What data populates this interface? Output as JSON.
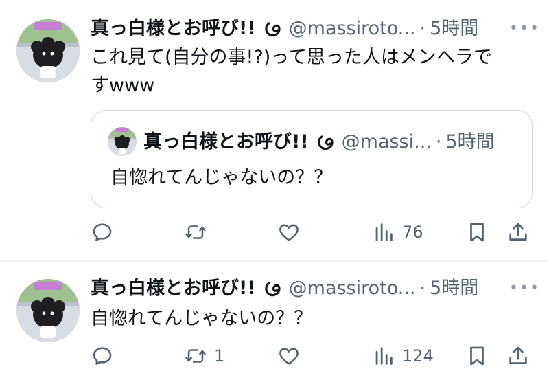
{
  "posts": [
    {
      "display_name": "真っ白様とお呼び!!",
      "handle": "@massiroto...",
      "separator": "·",
      "time": "5時間",
      "more": "•••",
      "text_line1": "これ見て(自分の事!?)って思った人はメンヘラで",
      "text_line2": "すwww",
      "quote": {
        "display_name": "真っ白様とお呼び!!",
        "handle": "@massi...",
        "separator": "·",
        "time": "5時間",
        "text": "自惚れてんじゃないの？？"
      },
      "actions": {
        "reply_count": "",
        "repost_count": "",
        "like_count": "",
        "views_count": "76"
      }
    },
    {
      "display_name": "真っ白様とお呼び!!",
      "handle": "@massiroto...",
      "separator": "·",
      "time": "5時間",
      "more": "•••",
      "text_line1": "自惚れてんじゃないの？？",
      "actions": {
        "reply_count": "",
        "repost_count": "1",
        "like_count": "",
        "views_count": "124"
      }
    }
  ],
  "colors": {
    "text": "#0f1419",
    "secondary": "#536471",
    "border": "#cfd9de",
    "divider": "#eff3f4"
  },
  "icons": [
    "reply-icon",
    "repost-icon",
    "like-icon",
    "views-icon",
    "bookmark-icon",
    "share-icon",
    "more-icon",
    "badge-icon"
  ]
}
